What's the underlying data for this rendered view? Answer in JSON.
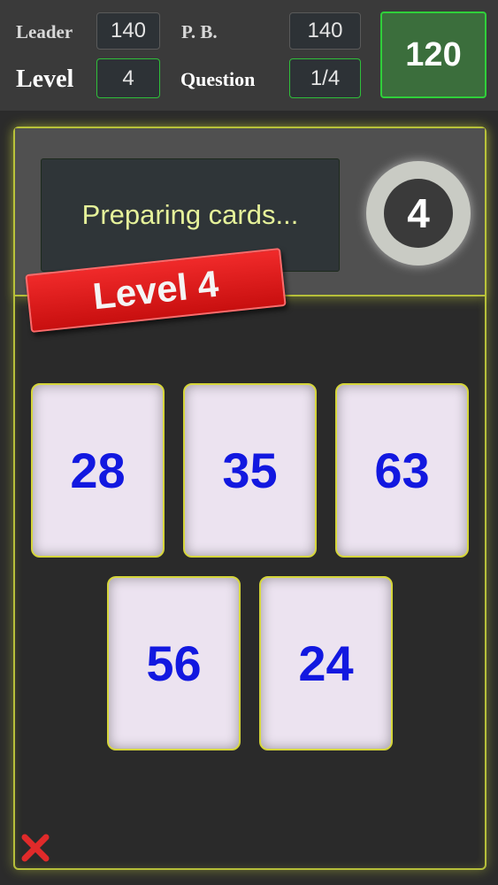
{
  "header": {
    "leader_label": "Leader",
    "leader_value": "140",
    "pb_label": "P. B.",
    "pb_value": "140",
    "level_label": "Level",
    "level_value": "4",
    "question_label": "Question",
    "question_value": "1/4",
    "score": "120"
  },
  "board": {
    "status_text": "Preparing cards...",
    "countdown": "4",
    "level_banner": "Level 4",
    "cards": [
      "28",
      "35",
      "63",
      "56",
      "24"
    ],
    "quit_icon": "close-x-icon"
  },
  "colors": {
    "background": "#2b2b2b",
    "board_border": "#b6bf3a",
    "card_text": "#1218e0",
    "banner": "#e01a1a",
    "score_box": "#3b6e3c",
    "quit": "#e02a2a"
  }
}
